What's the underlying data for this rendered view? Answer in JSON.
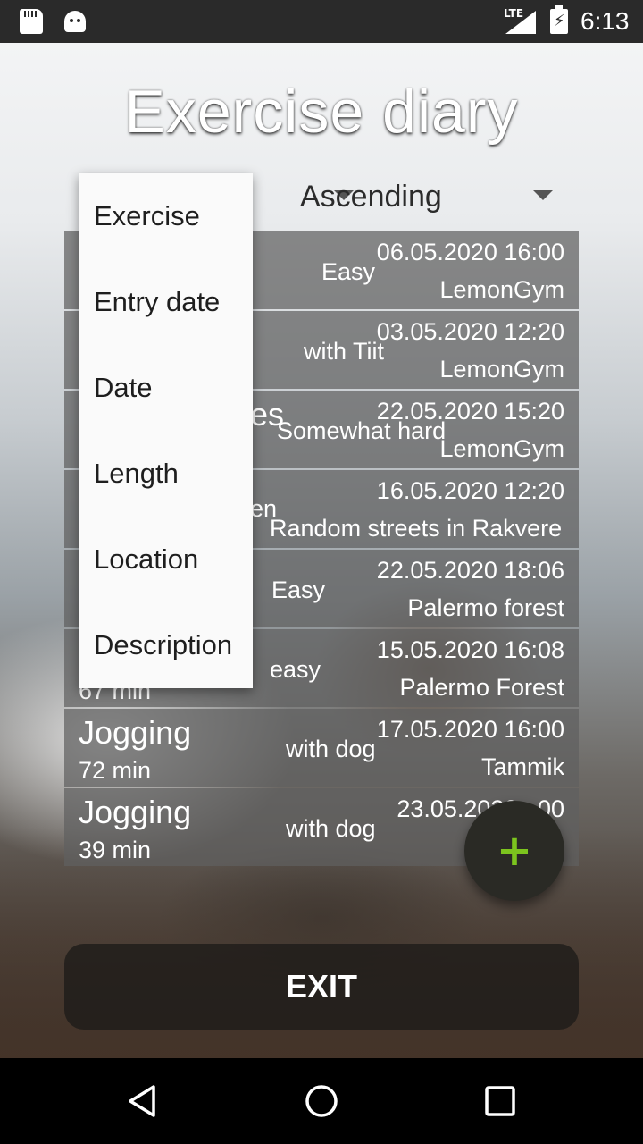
{
  "status_bar": {
    "network": "LTE",
    "battery_glyph": "⚡",
    "time": "6:13"
  },
  "app": {
    "title": "Exercise diary"
  },
  "sort": {
    "order_value": "Ascending",
    "field_options": [
      "Exercise",
      "Entry date",
      "Date",
      "Length",
      "Location",
      "Description"
    ]
  },
  "entries": [
    {
      "exercise": "",
      "length": "",
      "description": "Easy",
      "date": "06.05.2020 16:00",
      "location": "LemonGym"
    },
    {
      "exercise": "",
      "length": "",
      "description": "with Tiit",
      "date": "03.05.2020 12:20",
      "location": "LemonGym"
    },
    {
      "exercise": "es",
      "length": "",
      "description": "Somewhat hard",
      "date": "22.05.2020 15:20",
      "location": "LemonGym"
    },
    {
      "exercise": "en",
      "length": "",
      "description": "Random streets in Rakvere",
      "date": "16.05.2020 12:20",
      "location": ""
    },
    {
      "exercise": "",
      "length": "",
      "description": "Easy",
      "date": "22.05.2020 18:06",
      "location": "Palermo forest"
    },
    {
      "exercise": "",
      "length": "67 min",
      "description": "easy",
      "date": "15.05.2020 16:08",
      "location": "Palermo Forest"
    },
    {
      "exercise": "Jogging",
      "length": "72 min",
      "description": "with dog",
      "date": "17.05.2020 16:00",
      "location": "Tammik"
    },
    {
      "exercise": "Jogging",
      "length": "39 min",
      "description": "with dog",
      "date": "23.05.2020 ..00",
      "location": ""
    }
  ],
  "fab": {
    "label": "+",
    "icon": "plus-icon"
  },
  "exit": {
    "label": "EXIT"
  },
  "colors": {
    "fab_icon": "#7cc41e",
    "row_bg": "#5f5f5f",
    "dropdown_bg": "#fafafa"
  }
}
